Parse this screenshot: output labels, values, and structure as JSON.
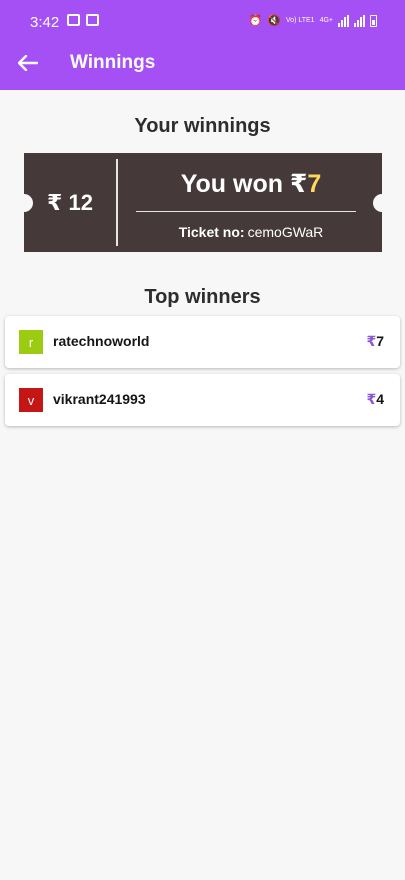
{
  "status_bar": {
    "time": "3:42",
    "network": "Vo) LTE1",
    "network2": "4G+"
  },
  "app_bar": {
    "title": "Winnings",
    "back_icon": "arrow-left-icon"
  },
  "winnings": {
    "heading": "Your winnings",
    "ticket": {
      "stake": "₹ 12",
      "won_prefix": "You won ",
      "won_currency": "₹",
      "won_amount": "7",
      "ticket_label": "Ticket no:",
      "ticket_code": "cemoGWaR"
    }
  },
  "top_winners": {
    "heading": "Top winners",
    "items": [
      {
        "initial": "r",
        "name": "ratechnoworld",
        "currency": "₹",
        "amount": "7",
        "avatar_color": "#9ccc12"
      },
      {
        "initial": "v",
        "name": "vikrant241993",
        "currency": "₹",
        "amount": "4",
        "avatar_color": "#c51616"
      }
    ]
  },
  "colors": {
    "app_bar": "#a550f4",
    "ticket_bg": "#45393a",
    "won_amount": "#ffd95a",
    "rupee_accent": "#8c57d6"
  }
}
